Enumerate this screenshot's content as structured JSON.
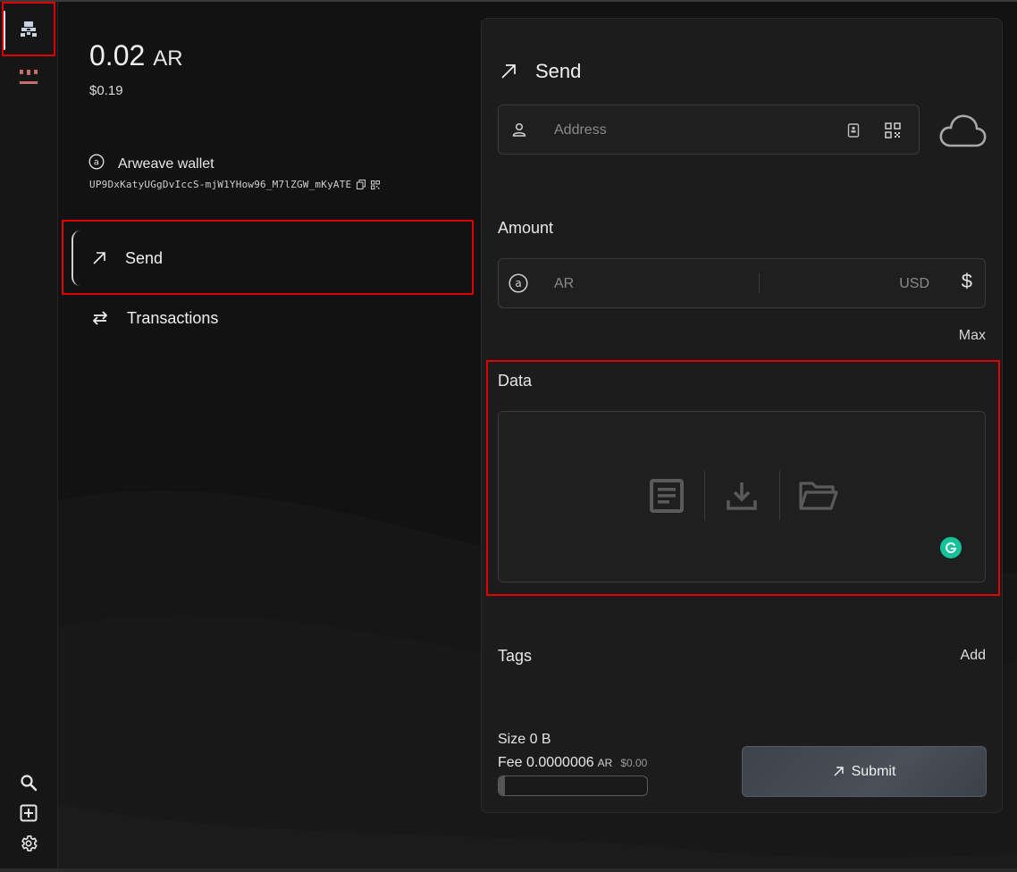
{
  "balance": {
    "amount": "0.02",
    "unit": "AR",
    "usd": "$0.19"
  },
  "wallet": {
    "name": "Arweave wallet",
    "address": "UP9DxKatyUGgDvIccS-mjW1YHow96_M7lZGW_mKyATE"
  },
  "nav": {
    "send": "Send",
    "transactions": "Transactions"
  },
  "send_panel": {
    "title": "Send",
    "address_placeholder": "Address",
    "amount_label": "Amount",
    "ar_placeholder": "AR",
    "usd_placeholder": "USD",
    "currency_symbol": "$",
    "max_label": "Max",
    "data_label": "Data",
    "tags_label": "Tags",
    "add_label": "Add",
    "size_text": "Size 0 B",
    "fee_text": "Fee 0.0000006",
    "fee_unit": "AR",
    "fee_usd": "$0.00",
    "fee_progress": 0.04,
    "submit_label": "Submit"
  },
  "icons": {
    "sidebar": [
      "wallet-icon",
      "apps-icon",
      "search-icon",
      "add-icon",
      "settings-icon"
    ],
    "panel": [
      "arrow-up-right-icon",
      "user-icon",
      "contacts-icon",
      "qr-code-icon",
      "cloud-icon",
      "ar-coin-icon",
      "document-icon",
      "download-icon",
      "folder-icon",
      "grammarly-icon"
    ]
  },
  "colors": {
    "highlight": "#e00000",
    "background": "#121212",
    "panel": "#1c1c1c",
    "grammarly": "#15c39a",
    "apps_accent": "#c27066"
  }
}
